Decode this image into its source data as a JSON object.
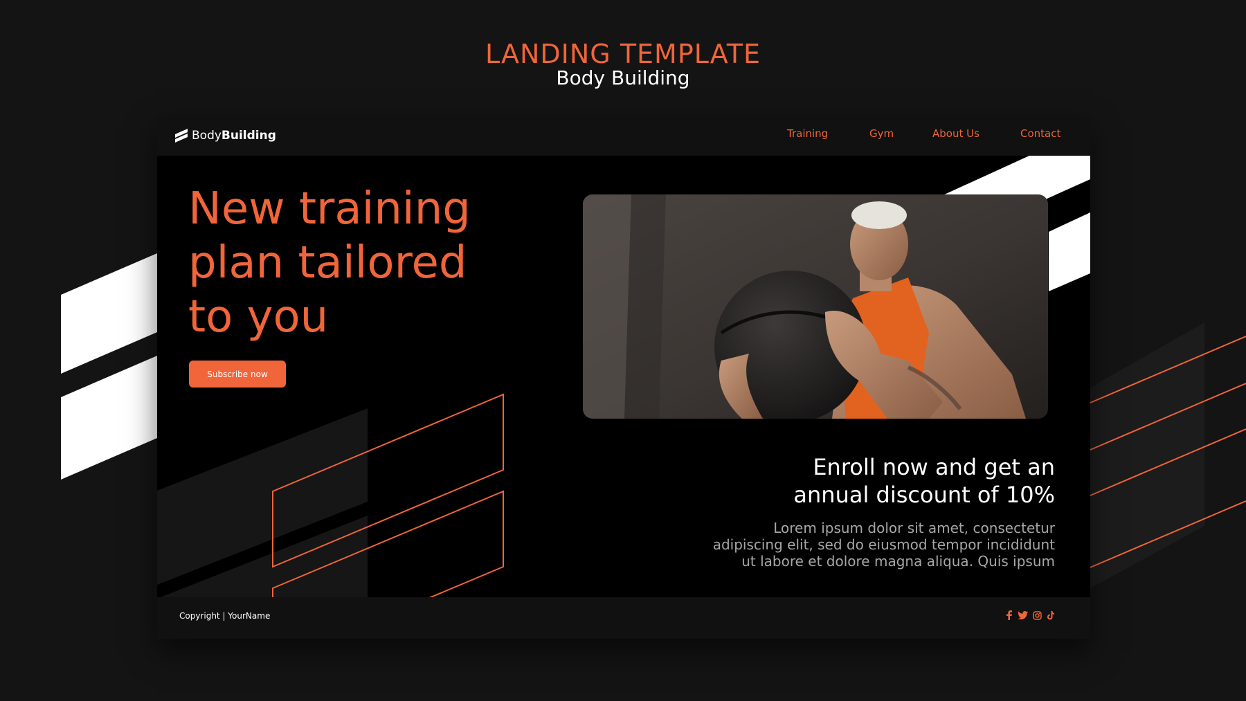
{
  "page_header": {
    "title": "LANDING TEMPLATE",
    "subtitle": "Body Building"
  },
  "navbar": {
    "logo_regular": "Body",
    "logo_bold": "Building",
    "items": [
      {
        "label": "Training"
      },
      {
        "label": "Gym"
      },
      {
        "label": "About Us"
      },
      {
        "label": "Contact"
      }
    ]
  },
  "hero": {
    "headline_lines": [
      "New training",
      "plan tailored",
      "to you"
    ],
    "cta_label": "Subscribe now",
    "offer_title_lines": [
      "Enroll now and get an",
      "annual discount of 10%"
    ],
    "offer_body_lines": [
      "Lorem ipsum dolor sit amet, consectetur",
      "adipiscing elit, sed do eiusmod tempor incididunt",
      "ut labore et dolore magna aliqua. Quis ipsum"
    ]
  },
  "footer": {
    "copyright": "Copyright | YourName",
    "socials": [
      "facebook-icon",
      "twitter-icon",
      "instagram-icon",
      "tiktok-icon"
    ]
  },
  "colors": {
    "accent": "#f0653a",
    "background": "#141414",
    "panel": "#000000",
    "bar": "#111111",
    "text_light": "#ffffff",
    "text_muted": "#a7a7a7"
  }
}
